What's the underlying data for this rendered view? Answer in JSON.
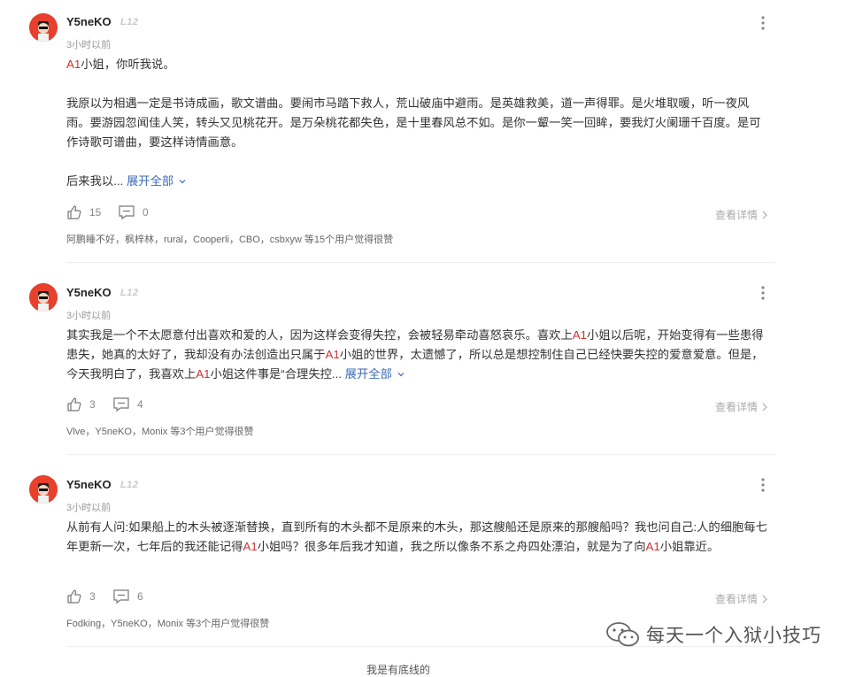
{
  "posts": [
    {
      "username": "Y5neKO",
      "level": "L12",
      "time": "3小时以前",
      "segments": [
        {
          "hl": "A1",
          "text": "小姐，你听我说。"
        },
        {
          "text": " "
        },
        {
          "text": "我原以为相遇一定是书诗成画，歌文谱曲。要闹市马踏下救人，荒山破庙中避雨。是英雄救美，道一声得罪。是火堆取暖，听一夜风雨。要游园忽闻佳人笑，转头又见桃花开。是万朵桃花都失色，是十里春风总不如。是你一颦一笑一回眸，要我灯火阑珊千百度。是可作诗歌可谱曲，要这样诗情画意。"
        },
        {
          "text": " "
        },
        {
          "text": "后来我以..."
        }
      ],
      "expand_label": "展开全部",
      "likes": "15",
      "comments": "0",
      "details_label": "查看详情",
      "likers": "阿鹏睡不好，枫梓林，rural，Cooperli，CBO，csbxyw 等15个用户觉得很赞"
    },
    {
      "username": "Y5neKO",
      "level": "L12",
      "time": "3小时以前",
      "p1": "其实我是一个不太愿意付出喜欢和爱的人，因为这样会变得失控，会被轻易牵动喜怒哀乐。喜欢上",
      "hl1": "A1",
      "p2": "小姐以后呢，开始变得有一些患得患失，她真的太好了，我却没有办法创造出只属于",
      "hl2": "A1",
      "p3": "小姐的世界，太遗憾了，所以总是想控制住自己已经快要失控的爱意爱意。但是，今天我明白了，我喜欢上",
      "hl3": "A1",
      "p4": "小姐这件事是“合理失控...",
      "expand_label": "展开全部",
      "likes": "3",
      "comments": "4",
      "details_label": "查看详情",
      "likers": "Vlve，Y5neKO，Monix 等3个用户觉得很赞"
    },
    {
      "username": "Y5neKO",
      "level": "L12",
      "time": "3小时以前",
      "p1": "从前有人问:如果船上的木头被逐渐替换，直到所有的木头都不是原来的木头，那这艘船还是原来的那艘船吗？我也问自己:人的细胞每七年更新一次，七年后的我还能记得",
      "hl1": "A1",
      "p2": "小姐吗？很多年后我才知道，我之所以像条不系之舟四处漂泊，就是为了向",
      "hl2": "A1",
      "p3": "小姐靠近。",
      "likes": "3",
      "comments": "6",
      "details_label": "查看详情",
      "likers": "Fodking，Y5neKO，Monix 等3个用户觉得很赞"
    }
  ],
  "watermark": "每天一个入狱小技巧",
  "bottom_cut_text": "我是有底线的",
  "colors": {
    "highlight": "#d0312d",
    "link": "#3c6ab3",
    "avatar_bg": "#e8402c"
  }
}
